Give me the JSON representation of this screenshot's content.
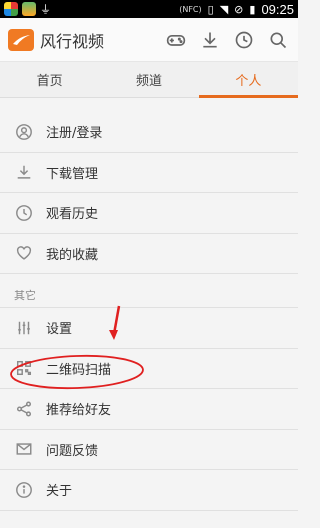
{
  "status_bar": {
    "nfc": "(NFC)",
    "time": "09:25"
  },
  "app_bar": {
    "title": "风行视频",
    "actions": [
      "gamepad-icon",
      "download-icon",
      "clock-icon",
      "search-icon"
    ]
  },
  "tabs": [
    {
      "label": "首页",
      "active": false
    },
    {
      "label": "频道",
      "active": false
    },
    {
      "label": "个人",
      "active": true
    }
  ],
  "menu": {
    "primary": [
      {
        "label": "注册/登录",
        "icon": "user-icon"
      },
      {
        "label": "下载管理",
        "icon": "download-icon"
      },
      {
        "label": "观看历史",
        "icon": "clock-icon"
      },
      {
        "label": "我的收藏",
        "icon": "heart-icon"
      }
    ],
    "section_label": "其它",
    "secondary": [
      {
        "label": "设置",
        "icon": "sliders-icon"
      },
      {
        "label": "二维码扫描",
        "icon": "qr-icon"
      },
      {
        "label": "推荐给好友",
        "icon": "share-icon"
      },
      {
        "label": "问题反馈",
        "icon": "mail-icon"
      },
      {
        "label": "关于",
        "icon": "info-icon"
      }
    ]
  },
  "colors": {
    "accent": "#e66b1e",
    "annotation": "#e02020"
  }
}
